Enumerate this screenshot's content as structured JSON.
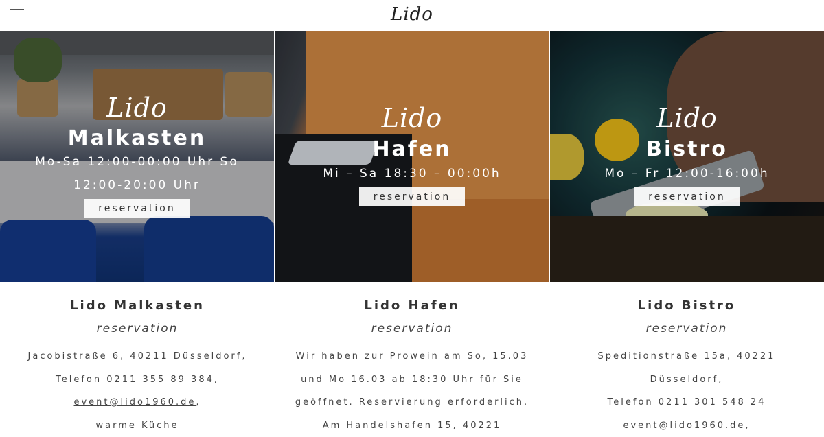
{
  "header": {
    "logo": "Lido",
    "menu_icon": "hamburger-menu-icon"
  },
  "panels": [
    {
      "script_logo": "Lido",
      "name": "Malkasten",
      "hours_line1": "Mo-Sa 12:00-00:00 Uhr So",
      "hours_line2": "12:00-20:00 Uhr",
      "button": "reservation"
    },
    {
      "script_logo": "Lido",
      "name": "Hafen",
      "hours_line1": "Mi – Sa 18:30 – 00:00h",
      "button": "reservation"
    },
    {
      "script_logo": "Lido",
      "name": "Bistro",
      "hours_line1": "Mo – Fr 12:00-16:00h",
      "button": "reservation"
    }
  ],
  "info": [
    {
      "title": "Lido Malkasten",
      "reservation": "reservation",
      "lines": [
        "Jacobistraße 6, 40211 Düsseldorf,",
        "Telefon 0211 355 89 384,",
        "event@lido1960.de",
        "warme Küche"
      ],
      "email_suffix": ","
    },
    {
      "title": "Lido Hafen",
      "reservation": "reservation",
      "lines": [
        "Wir haben zur Prowein am So, 15.03",
        "und Mo 16.03 ab 18:30 Uhr für Sie",
        "geöffnet. Reservierung erforderlich.",
        "Am Handelshafen 15, 40221"
      ]
    },
    {
      "title": "Lido Bistro",
      "reservation": "reservation",
      "lines": [
        "Speditionstraße 15a, 40221",
        "Düsseldorf,",
        "Telefon 0211 301 548 24",
        "event@lido1960.de"
      ],
      "email_suffix": ","
    }
  ]
}
